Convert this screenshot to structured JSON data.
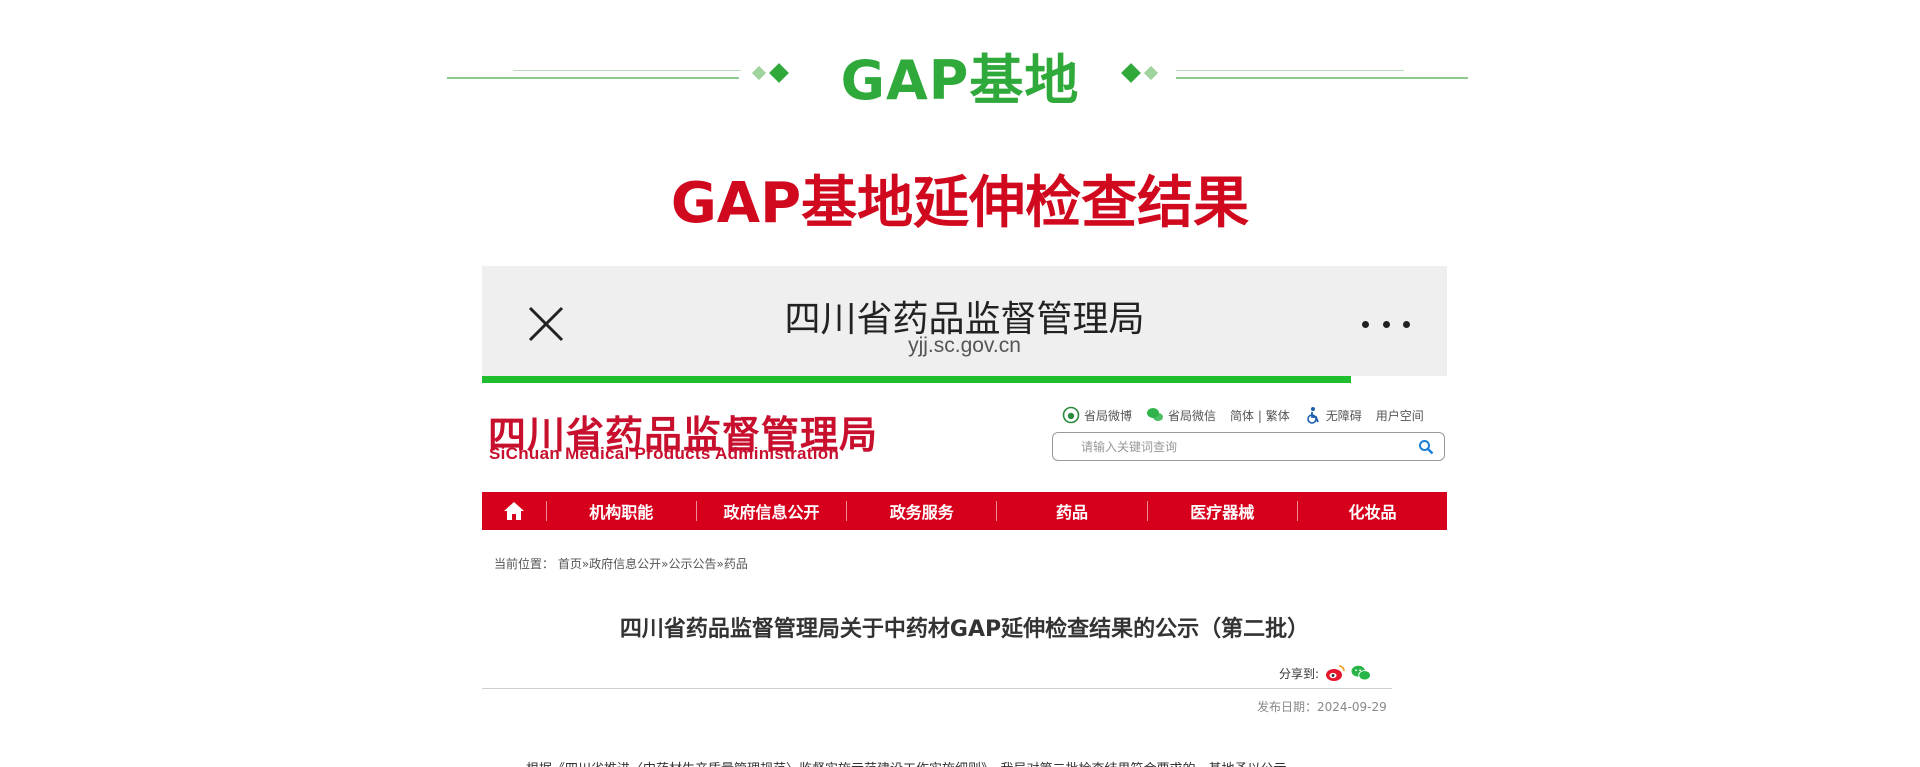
{
  "theme": {
    "section_green": "#2ea93a",
    "red": "#d0091e",
    "diamond_dark": "#2ea93a",
    "diamond_light": "#9fd49f"
  },
  "section": {
    "title": "GAP基地"
  },
  "subtitle": "GAP基地延伸检查结果",
  "browser": {
    "title": "四川省药品监督管理局",
    "url": "yjj.sc.gov.cn",
    "progress": 0.9
  },
  "site": {
    "logo_cn": "四川省药品监督管理局",
    "logo_en": "SiChuan Medical Products Administration",
    "top_links": [
      {
        "label": "省局微博",
        "icon": "weibo-icon"
      },
      {
        "label": "省局微信",
        "icon": "wechat-icon"
      },
      {
        "label": "简体 | 繁体",
        "icon": ""
      },
      {
        "label": "无障碍",
        "icon": "accessibility-icon"
      },
      {
        "label": "用户空间",
        "icon": ""
      }
    ],
    "search_placeholder": "请输入关键词查询",
    "nav": [
      "机构职能",
      "政府信息公开",
      "政务服务",
      "药品",
      "医疗器械",
      "化妆品"
    ],
    "breadcrumb": "当前位置：  首页»政府信息公开»公示公告»药品",
    "article_title": "四川省药品监督管理局关于中药材GAP延伸检查结果的公示（第二批）",
    "share_label": "分享到:",
    "pub_date": "发布日期：2024-09-29",
    "body_text": "根据《四川省推进〈中药材生产质量管理规范〉监督实施示范建设工作实施细则》，我局对第二批检查结果符合要求的，基地予以公示"
  }
}
